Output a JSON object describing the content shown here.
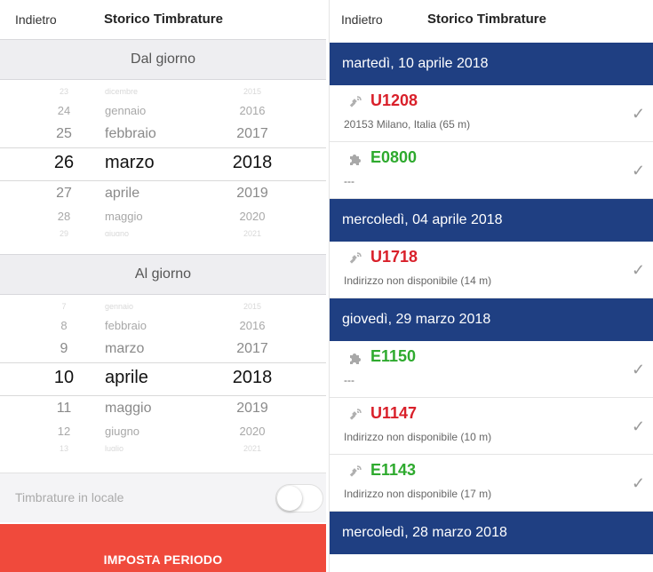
{
  "left": {
    "nav": {
      "back": "Indietro",
      "title": "Storico Timbrature"
    },
    "from_header": "Dal giorno",
    "from_picker": {
      "rows": [
        {
          "day": "23",
          "month": "dicembre",
          "year": "2015"
        },
        {
          "day": "24",
          "month": "gennaio",
          "year": "2016"
        },
        {
          "day": "25",
          "month": "febbraio",
          "year": "2017"
        },
        {
          "day": "26",
          "month": "marzo",
          "year": "2018"
        },
        {
          "day": "27",
          "month": "aprile",
          "year": "2019"
        },
        {
          "day": "28",
          "month": "maggio",
          "year": "2020"
        },
        {
          "day": "29",
          "month": "giugno",
          "year": "2021"
        }
      ]
    },
    "to_header": "Al giorno",
    "to_picker": {
      "rows": [
        {
          "day": "7",
          "month": "gennaio",
          "year": "2015"
        },
        {
          "day": "8",
          "month": "febbraio",
          "year": "2016"
        },
        {
          "day": "9",
          "month": "marzo",
          "year": "2017"
        },
        {
          "day": "10",
          "month": "aprile",
          "year": "2018"
        },
        {
          "day": "11",
          "month": "maggio",
          "year": "2019"
        },
        {
          "day": "12",
          "month": "giugno",
          "year": "2020"
        },
        {
          "day": "13",
          "month": "luglio",
          "year": "2021"
        }
      ]
    },
    "toggle_label": "Timbrature in locale",
    "toggle_on": false,
    "set_button": "IMPOSTA PERIODO"
  },
  "right": {
    "nav": {
      "back": "Indietro",
      "title": "Storico Timbrature"
    },
    "groups": [
      {
        "date": "martedì, 10 aprile 2018",
        "entries": [
          {
            "code": "U1208",
            "type": "uscita",
            "icon": "satellite-icon",
            "address": "20153 Milano, Italia (65 m)"
          },
          {
            "code": "E0800",
            "type": "entrata",
            "icon": "puzzle-icon",
            "address": "---"
          }
        ]
      },
      {
        "date": "mercoledì, 04 aprile 2018",
        "entries": [
          {
            "code": "U1718",
            "type": "uscita",
            "icon": "satellite-icon",
            "address": "Indirizzo non disponibile (14 m)"
          }
        ]
      },
      {
        "date": "giovedì, 29 marzo 2018",
        "entries": [
          {
            "code": "E1150",
            "type": "entrata",
            "icon": "puzzle-icon",
            "address": "---"
          },
          {
            "code": "U1147",
            "type": "uscita",
            "icon": "satellite-icon",
            "address": "Indirizzo non disponibile (10 m)"
          },
          {
            "code": "E1143",
            "type": "entrata",
            "icon": "satellite-icon",
            "address": "Indirizzo non disponibile (17 m)"
          }
        ]
      },
      {
        "date": "mercoledì, 28 marzo 2018",
        "entries": []
      }
    ],
    "check_glyph": "✓",
    "colors": {
      "header_bg": "#1f3f82",
      "uscita": "#d9202a",
      "entrata": "#2eaa2e",
      "button_bg": "#f04a3c"
    }
  }
}
